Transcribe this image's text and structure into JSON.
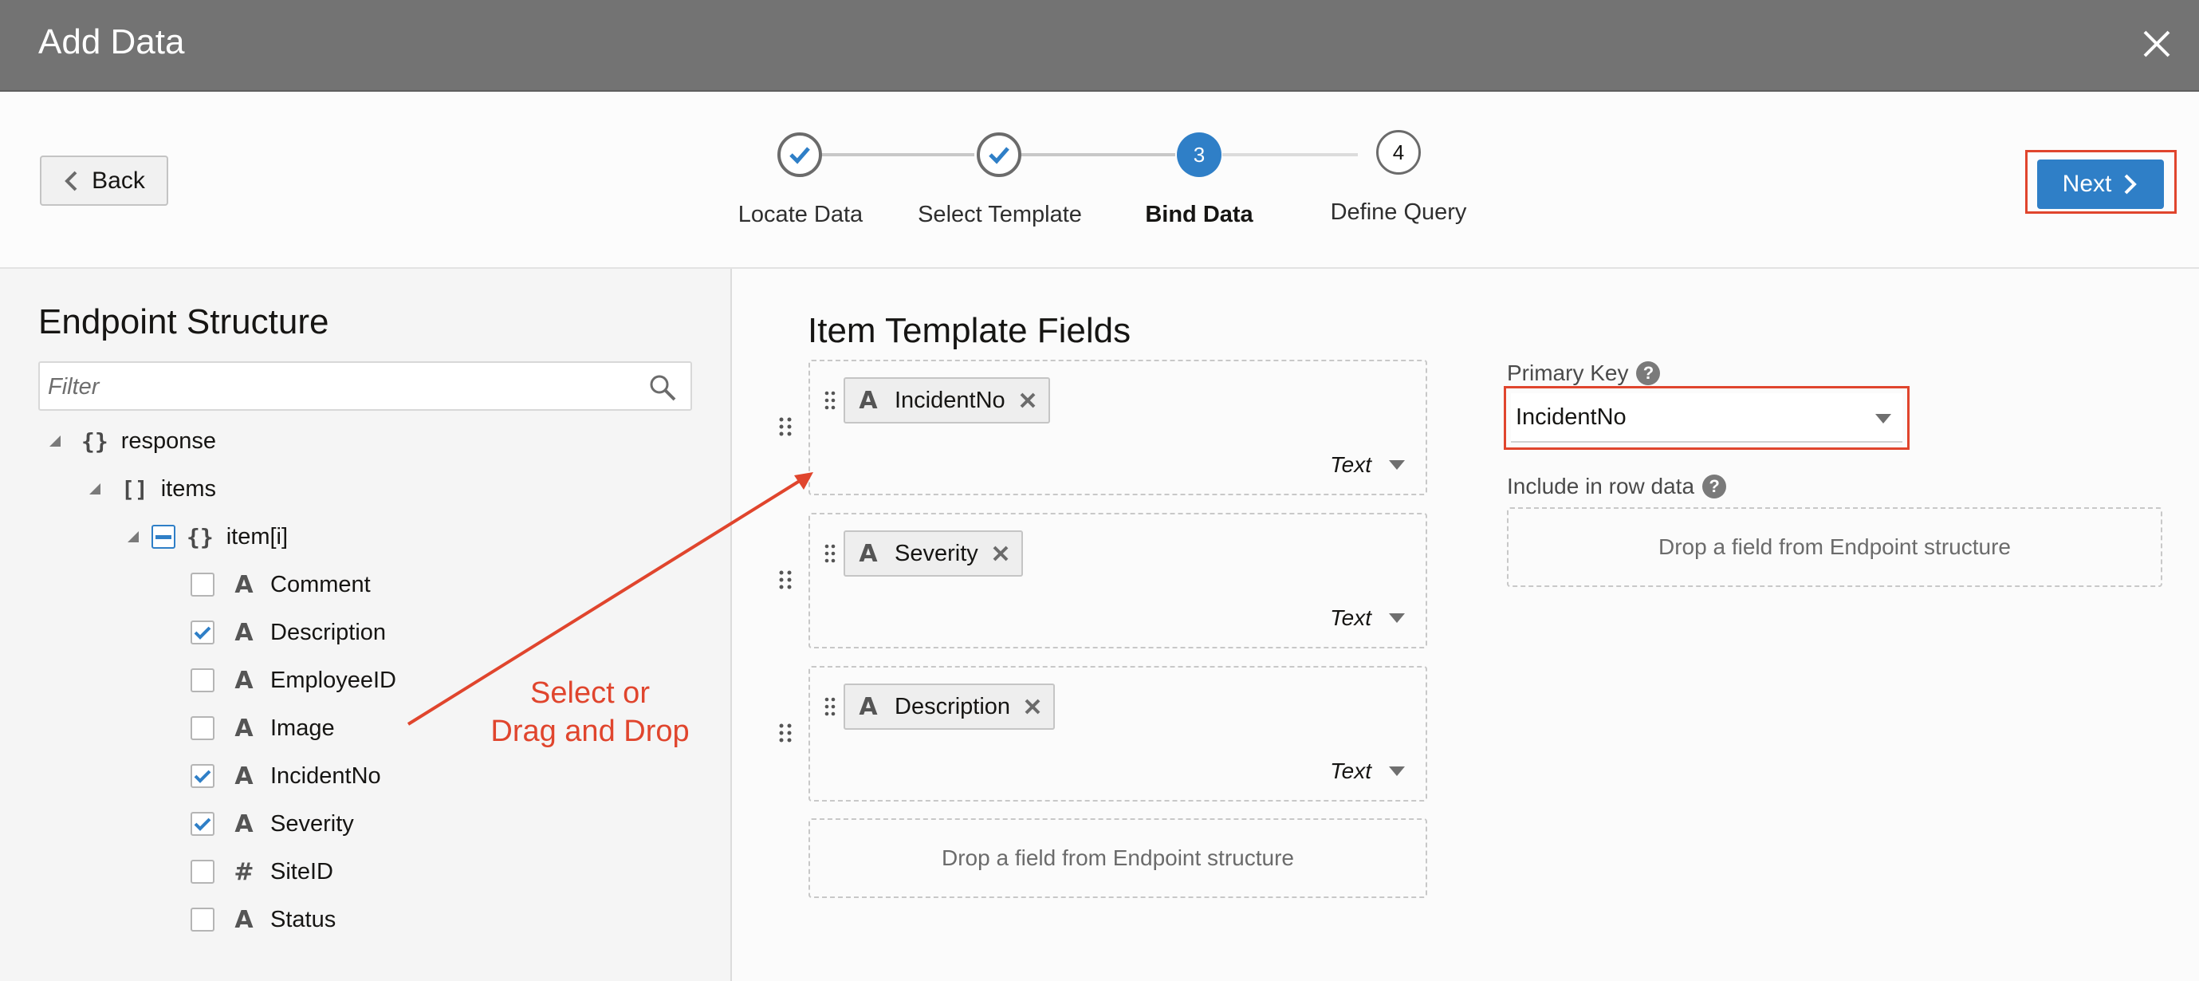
{
  "dialog": {
    "title": "Add Data",
    "close_icon": "close-icon"
  },
  "header": {
    "back_label": "Back",
    "next_label": "Next",
    "steps": [
      {
        "label": "Locate Data",
        "state": "done"
      },
      {
        "label": "Select Template",
        "state": "done"
      },
      {
        "label": "Bind Data",
        "number": "3",
        "state": "active"
      },
      {
        "label": "Define Query",
        "number": "4",
        "state": "todo"
      }
    ]
  },
  "endpoint": {
    "title": "Endpoint Structure",
    "filter_placeholder": "Filter",
    "tree": {
      "root": {
        "glyph": "{}",
        "label": "response"
      },
      "items": {
        "glyph": "[]",
        "label": "items"
      },
      "item": {
        "glyph": "{}",
        "label": "item[i]"
      },
      "fields": [
        {
          "type": "A",
          "label": "Comment",
          "checked": false
        },
        {
          "type": "A",
          "label": "Description",
          "checked": true
        },
        {
          "type": "A",
          "label": "EmployeeID",
          "checked": false
        },
        {
          "type": "A",
          "label": "Image",
          "checked": false
        },
        {
          "type": "A",
          "label": "IncidentNo",
          "checked": true
        },
        {
          "type": "A",
          "label": "Severity",
          "checked": true
        },
        {
          "type": "#",
          "label": "SiteID",
          "checked": false
        },
        {
          "type": "A",
          "label": "Status",
          "checked": false
        }
      ]
    }
  },
  "template_fields": {
    "title": "Item Template Fields",
    "cards": [
      {
        "field": "IncidentNo",
        "type": "Text"
      },
      {
        "field": "Severity",
        "type": "Text"
      },
      {
        "field": "Description",
        "type": "Text"
      }
    ],
    "drop_hint": "Drop a field from Endpoint structure"
  },
  "primary_key": {
    "label": "Primary Key",
    "value": "IncidentNo",
    "help": "?"
  },
  "row_data": {
    "label": "Include in row data",
    "help": "?",
    "drop_hint": "Drop a field from Endpoint structure"
  },
  "annotation": {
    "line1": "Select or",
    "line2": "Drag and Drop"
  },
  "colors": {
    "accent": "#2f7fc7",
    "highlight": "#e0452d",
    "titlebar": "#737373"
  }
}
